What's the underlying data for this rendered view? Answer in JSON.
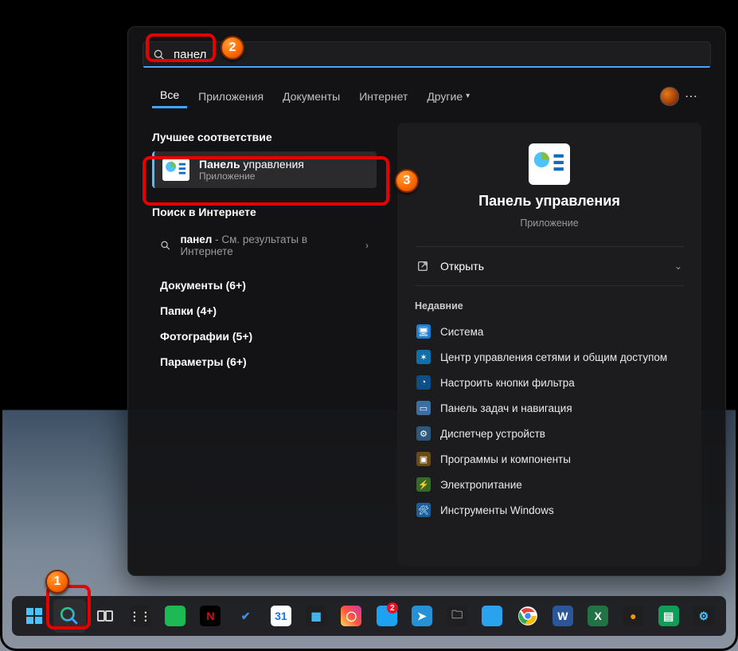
{
  "search": {
    "value": "панел"
  },
  "tabs": [
    {
      "label": "Все",
      "active": true,
      "dropdown": false
    },
    {
      "label": "Приложения",
      "active": false,
      "dropdown": false
    },
    {
      "label": "Документы",
      "active": false,
      "dropdown": false
    },
    {
      "label": "Интернет",
      "active": false,
      "dropdown": false
    },
    {
      "label": "Другие",
      "active": false,
      "dropdown": true
    }
  ],
  "left": {
    "best_header": "Лучшее соответствие",
    "best_match": {
      "title_hl": "Панель",
      "title_rest": " управления",
      "subtitle": "Приложение"
    },
    "web_header": "Поиск в Интернете",
    "web": {
      "query": "панел",
      "suffix": " - См. результаты в Интернете"
    },
    "categories": [
      {
        "label": "Документы (6+)"
      },
      {
        "label": "Папки (4+)"
      },
      {
        "label": "Фотографии (5+)"
      },
      {
        "label": "Параметры (6+)"
      }
    ]
  },
  "right": {
    "title": "Панель управления",
    "subtitle": "Приложение",
    "open_label": "Открыть",
    "recent_header": "Недавние",
    "recent": [
      {
        "label": "Система"
      },
      {
        "label": "Центр управления сетями и общим доступом"
      },
      {
        "label": "Настроить кнопки фильтра"
      },
      {
        "label": "Панель задач и навигация"
      },
      {
        "label": "Диспетчер устройств"
      },
      {
        "label": "Программы и компоненты"
      },
      {
        "label": "Электропитание"
      },
      {
        "label": "Инструменты Windows"
      }
    ]
  },
  "taskbar": {
    "items": [
      {
        "name": "start-button",
        "kind": "start"
      },
      {
        "name": "search-button",
        "kind": "search",
        "active": true
      },
      {
        "name": "taskview-button",
        "kind": "taskview"
      },
      {
        "name": "calculator-app",
        "kind": "sq",
        "bg": "#1f1f1f",
        "glyph": "⋮⋮"
      },
      {
        "name": "spotify-app",
        "kind": "sq",
        "bg": "#1db954",
        "glyph": ""
      },
      {
        "name": "netflix-app",
        "kind": "sq",
        "bg": "#000",
        "glyph": "N",
        "fg": "#e50914"
      },
      {
        "name": "todo-app",
        "kind": "sq",
        "bg": "transparent",
        "glyph": "✔",
        "fg": "#3a8fe0"
      },
      {
        "name": "calendar-app",
        "kind": "sq",
        "bg": "#fff",
        "glyph": "31",
        "fg": "#1a73e8"
      },
      {
        "name": "photos-app",
        "kind": "sq",
        "bg": "#1f1f1f",
        "glyph": "▦",
        "fg": "#4cc2ff"
      },
      {
        "name": "instagram-app",
        "kind": "insta"
      },
      {
        "name": "twitter-app",
        "kind": "sq",
        "bg": "#1da1f2",
        "glyph": "",
        "badge": "2"
      },
      {
        "name": "telegram-app",
        "kind": "sq",
        "bg": "#2492d4",
        "glyph": "➤"
      },
      {
        "name": "files-app",
        "kind": "sq",
        "bg": "#1f1f1f",
        "glyph": "🗀",
        "fg": "#9aa0a6"
      },
      {
        "name": "notes-app",
        "kind": "sq",
        "bg": "#2aa3ef",
        "glyph": ""
      },
      {
        "name": "chrome-app",
        "kind": "chrome"
      },
      {
        "name": "word-app",
        "kind": "sq",
        "bg": "#2b579a",
        "glyph": "W"
      },
      {
        "name": "excel-app",
        "kind": "sq",
        "bg": "#217346",
        "glyph": "X"
      },
      {
        "name": "firefox-app",
        "kind": "sq",
        "bg": "#1f1f1f",
        "glyph": "●",
        "fg": "#ff9500"
      },
      {
        "name": "sheets-app",
        "kind": "sq",
        "bg": "#0f9d58",
        "glyph": "▤"
      },
      {
        "name": "settings-app",
        "kind": "sq",
        "bg": "#1f1f1f",
        "glyph": "⚙",
        "fg": "#4cc2ff"
      }
    ]
  }
}
